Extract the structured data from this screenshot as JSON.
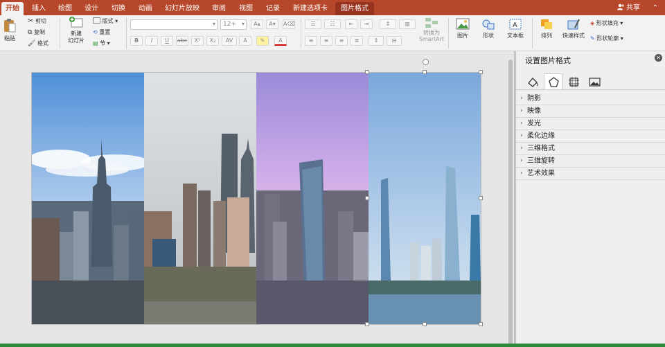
{
  "tabs": [
    {
      "label": "开始",
      "active": true
    },
    {
      "label": "插入"
    },
    {
      "label": "绘图"
    },
    {
      "label": "设计"
    },
    {
      "label": "切换"
    },
    {
      "label": "动画"
    },
    {
      "label": "幻灯片放映"
    },
    {
      "label": "审阅"
    },
    {
      "label": "视图"
    },
    {
      "label": "记录"
    },
    {
      "label": "新建选项卡"
    },
    {
      "label": "图片格式",
      "contextual": true
    }
  ],
  "share_label": "共享",
  "collapse_glyph": "⌃",
  "ribbon": {
    "paste": "粘贴",
    "cut": "剪切",
    "copy": "复制",
    "format_painter": "格式",
    "new_slide_line1": "新建",
    "new_slide_line2": "幻灯片",
    "layout": "版式",
    "reset": "重置",
    "section": "节",
    "font_size": "12+",
    "convert_smartart_line1": "转换为",
    "convert_smartart_line2": "SmartArt",
    "picture": "图片",
    "shapes": "形状",
    "textbox": "文本框",
    "arrange": "排列",
    "quick_styles": "快速样式",
    "shape_fill": "形状填充",
    "shape_outline": "形状轮廓",
    "bold": "B",
    "italic": "I",
    "underline": "U",
    "strike": "abc",
    "superscript": "X²",
    "subscript": "X₂",
    "char_spacing": "AV",
    "text_effects": "A",
    "font_color": "A"
  },
  "pane": {
    "title": "设置图片格式",
    "tabs": [
      "fill-line-icon",
      "effects-pentagon-icon",
      "size-properties-icon",
      "picture-icon"
    ],
    "sections": [
      "阴影",
      "映像",
      "发光",
      "柔化边缘",
      "三维格式",
      "三维旋转",
      "艺术效果"
    ]
  },
  "colors": {
    "brand": "#b7472a",
    "contextual": "#96331e"
  }
}
